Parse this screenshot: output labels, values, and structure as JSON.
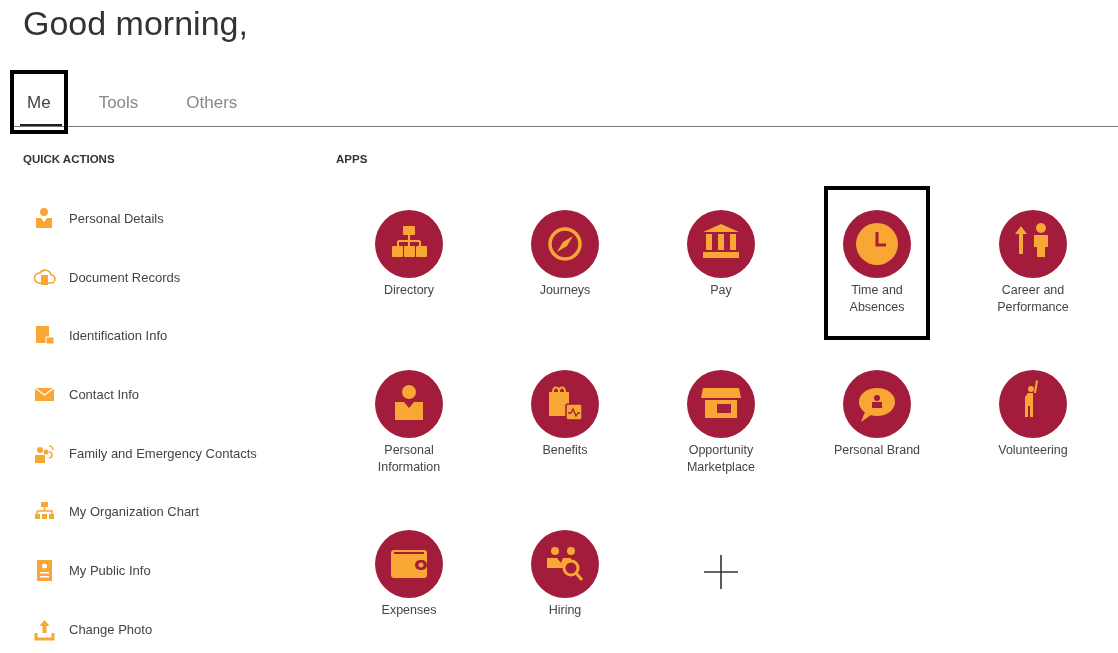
{
  "greeting": "Good morning,",
  "tabs": [
    {
      "label": "Me",
      "selected": true,
      "highlighted": true
    },
    {
      "label": "Tools",
      "selected": false,
      "highlighted": false
    },
    {
      "label": "Others",
      "selected": false,
      "highlighted": false
    }
  ],
  "quick_actions": {
    "title": "QUICK ACTIONS",
    "items": [
      {
        "label": "Personal Details"
      },
      {
        "label": "Document Records"
      },
      {
        "label": "Identification Info"
      },
      {
        "label": "Contact Info"
      },
      {
        "label": "Family and Emergency Contacts"
      },
      {
        "label": "My Organization Chart"
      },
      {
        "label": "My Public Info"
      },
      {
        "label": "Change Photo"
      }
    ]
  },
  "apps": {
    "title": "APPS",
    "items": [
      {
        "kind": "app",
        "label": "Directory",
        "highlighted": false
      },
      {
        "kind": "app",
        "label": "Journeys",
        "highlighted": false
      },
      {
        "kind": "app",
        "label": "Pay",
        "highlighted": false
      },
      {
        "kind": "app",
        "label": "Time and Absences",
        "highlighted": true
      },
      {
        "kind": "app",
        "label": "Career and Performance",
        "highlighted": false
      },
      {
        "kind": "app",
        "label": "Personal Information",
        "highlighted": false
      },
      {
        "kind": "app",
        "label": "Benefits",
        "highlighted": false
      },
      {
        "kind": "app",
        "label": "Opportunity Marketplace",
        "highlighted": false
      },
      {
        "kind": "app",
        "label": "Personal Brand",
        "highlighted": false
      },
      {
        "kind": "app",
        "label": "Volunteering",
        "highlighted": false
      },
      {
        "kind": "app",
        "label": "Expenses",
        "highlighted": false
      },
      {
        "kind": "app",
        "label": "Hiring",
        "highlighted": false
      },
      {
        "kind": "add"
      }
    ]
  }
}
